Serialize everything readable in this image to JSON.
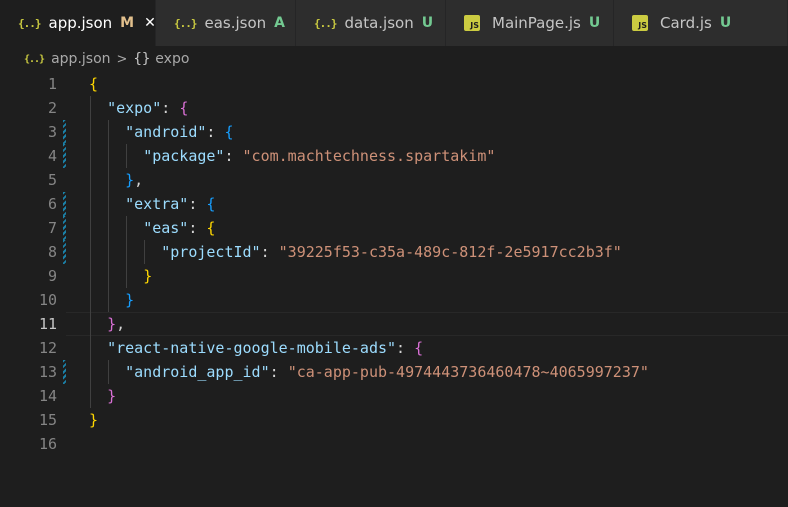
{
  "tabs": [
    {
      "name": "app.json",
      "status": "M",
      "icon": "json-icon",
      "active": true
    },
    {
      "name": "eas.json",
      "status": "A",
      "icon": "json-icon",
      "active": false
    },
    {
      "name": "data.json",
      "status": "U",
      "icon": "json-icon",
      "active": false
    },
    {
      "name": "MainPage.js",
      "status": "U",
      "icon": "js-icon",
      "active": false
    },
    {
      "name": "Card.js",
      "status": "U",
      "icon": "js-icon",
      "active": false
    }
  ],
  "icons": {
    "json": "{..}",
    "js": "JS",
    "close": "✕"
  },
  "breadcrumb": {
    "file": "app.json",
    "separator": ">",
    "symbol_icon": "{}",
    "symbol": "expo"
  },
  "editor": {
    "current_line": 11,
    "lines": [
      {
        "n": "1",
        "tokens": [
          {
            "t": "{",
            "c": "b1"
          }
        ]
      },
      {
        "n": "2",
        "tokens": [
          {
            "t": "  "
          },
          {
            "t": "\"expo\"",
            "c": "k"
          },
          {
            "t": ": "
          },
          {
            "t": "{",
            "c": "b2"
          }
        ]
      },
      {
        "n": "3",
        "tokens": [
          {
            "t": "    "
          },
          {
            "t": "\"android\"",
            "c": "k"
          },
          {
            "t": ": "
          },
          {
            "t": "{",
            "c": "b3"
          }
        ]
      },
      {
        "n": "4",
        "tokens": [
          {
            "t": "      "
          },
          {
            "t": "\"package\"",
            "c": "k"
          },
          {
            "t": ": "
          },
          {
            "t": "\"com.machtechness.spartakim\"",
            "c": "s"
          }
        ]
      },
      {
        "n": "5",
        "tokens": [
          {
            "t": "    "
          },
          {
            "t": "}",
            "c": "b3"
          },
          {
            "t": ","
          }
        ]
      },
      {
        "n": "6",
        "tokens": [
          {
            "t": "    "
          },
          {
            "t": "\"extra\"",
            "c": "k"
          },
          {
            "t": ": "
          },
          {
            "t": "{",
            "c": "b3"
          }
        ]
      },
      {
        "n": "7",
        "tokens": [
          {
            "t": "      "
          },
          {
            "t": "\"eas\"",
            "c": "k"
          },
          {
            "t": ": "
          },
          {
            "t": "{",
            "c": "b1"
          }
        ]
      },
      {
        "n": "8",
        "tokens": [
          {
            "t": "        "
          },
          {
            "t": "\"projectId\"",
            "c": "k"
          },
          {
            "t": ": "
          },
          {
            "t": "\"39225f53-c35a-489c-812f-2e5917cc2b3f\"",
            "c": "s"
          }
        ]
      },
      {
        "n": "9",
        "tokens": [
          {
            "t": "      "
          },
          {
            "t": "}",
            "c": "b1"
          }
        ]
      },
      {
        "n": "10",
        "tokens": [
          {
            "t": "    "
          },
          {
            "t": "}",
            "c": "b3"
          }
        ]
      },
      {
        "n": "11",
        "tokens": [
          {
            "t": "  "
          },
          {
            "t": "}",
            "c": "b2"
          },
          {
            "t": ","
          }
        ]
      },
      {
        "n": "12",
        "tokens": [
          {
            "t": "  "
          },
          {
            "t": "\"react-native-google-mobile-ads\"",
            "c": "k"
          },
          {
            "t": ": "
          },
          {
            "t": "{",
            "c": "b2"
          }
        ]
      },
      {
        "n": "13",
        "tokens": [
          {
            "t": "    "
          },
          {
            "t": "\"android_app_id\"",
            "c": "k"
          },
          {
            "t": ": "
          },
          {
            "t": "\"ca-app-pub-4974443736460478~4065997237\"",
            "c": "s"
          }
        ]
      },
      {
        "n": "14",
        "tokens": [
          {
            "t": "  "
          },
          {
            "t": "}",
            "c": "b2"
          }
        ]
      },
      {
        "n": "15",
        "tokens": [
          {
            "t": "}",
            "c": "b1"
          }
        ]
      },
      {
        "n": "16",
        "tokens": []
      }
    ]
  },
  "colors": {
    "background": "#1e1e1e",
    "key": "#9cdcfe",
    "string": "#ce9178",
    "bracket_gold": "#ffd700",
    "bracket_orchid": "#da70d6",
    "bracket_blue": "#179fff",
    "modified": "#e2c08d",
    "untracked": "#73c991"
  }
}
